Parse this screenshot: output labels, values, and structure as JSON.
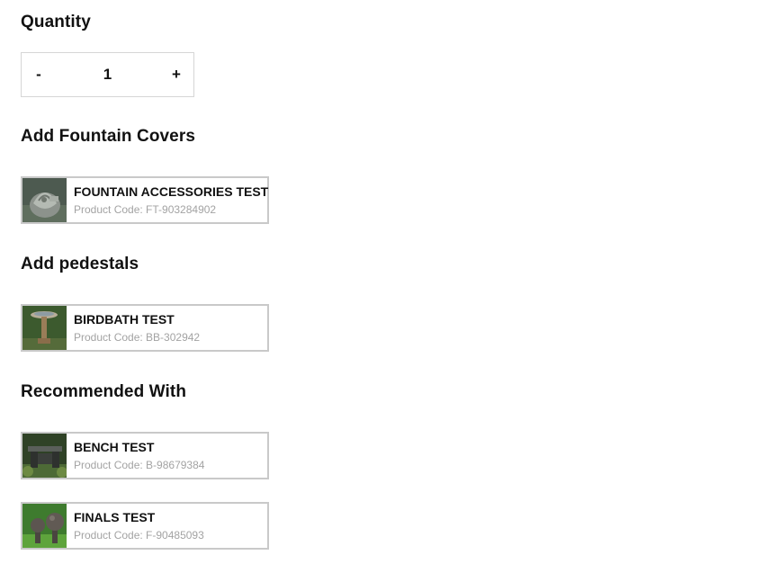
{
  "quantity": {
    "title": "Quantity",
    "decrement_label": "-",
    "value": "1",
    "increment_label": "+"
  },
  "fountain_covers": {
    "title": "Add Fountain Covers",
    "items": [
      {
        "name": "FOUNTAIN ACCESSORIES TEST",
        "code": "Product Code: FT-903284902",
        "image": "fountain-accessory-thumbnail"
      }
    ]
  },
  "pedestals": {
    "title": "Add pedestals",
    "items": [
      {
        "name": "BIRDBATH TEST",
        "code": "Product Code: BB-302942",
        "image": "birdbath-thumbnail"
      }
    ]
  },
  "recommended": {
    "title": "Recommended With",
    "items": [
      {
        "name": "BENCH TEST",
        "code": "Product Code: B-98679384",
        "image": "bench-thumbnail"
      },
      {
        "name": "FINALS TEST",
        "code": "Product Code: F-90485093",
        "image": "finials-thumbnail"
      }
    ]
  },
  "colors": {
    "border": "#c9c9c9",
    "text": "#111111",
    "muted": "#a3a3a3"
  }
}
